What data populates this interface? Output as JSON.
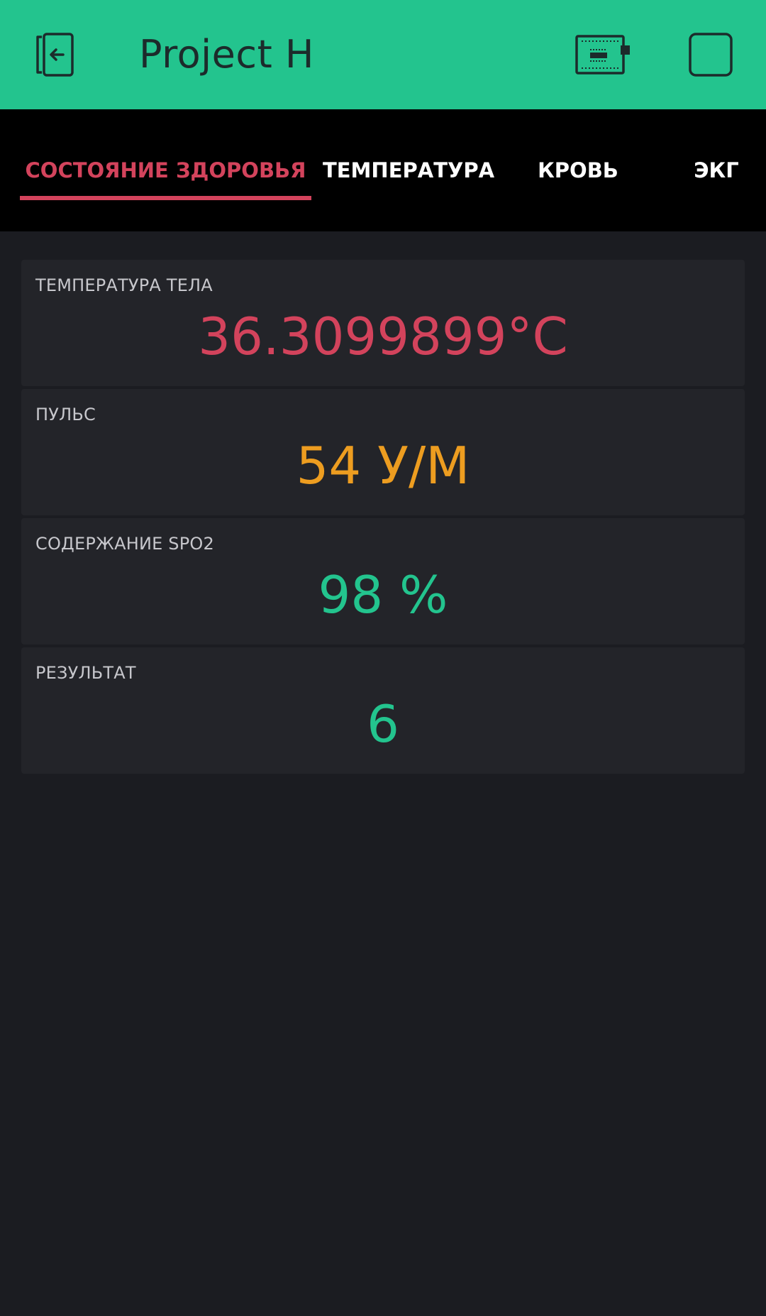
{
  "header": {
    "title": "Project H",
    "back_icon": "exit-icon",
    "board_icon": "device-board-icon",
    "square_icon": "square-icon"
  },
  "tabs": [
    {
      "label": "СОСТОЯНИЕ ЗДОРОВЬЯ",
      "active": true
    },
    {
      "label": "ТЕМПЕРАТУРА",
      "active": false
    },
    {
      "label": "КРОВЬ",
      "active": false
    },
    {
      "label": "ЭКГ",
      "active": false
    }
  ],
  "cards": [
    {
      "label": "ТЕМПЕРАТУРА ТЕЛА",
      "value": "36.3099899°C",
      "color": "#d3435c"
    },
    {
      "label": "ПУЛЬС",
      "value": "54 У/М",
      "color": "#ed9d20"
    },
    {
      "label": "СОДЕРЖАНИЕ SPO2",
      "value": "98 %",
      "color": "#23c48e"
    },
    {
      "label": "РЕЗУЛЬТАТ",
      "value": "6",
      "color": "#23c48e"
    }
  ],
  "colors": {
    "accent": "#23c48e",
    "active_tab": "#d3435c",
    "background": "#1b1c21",
    "card": "#232429"
  }
}
